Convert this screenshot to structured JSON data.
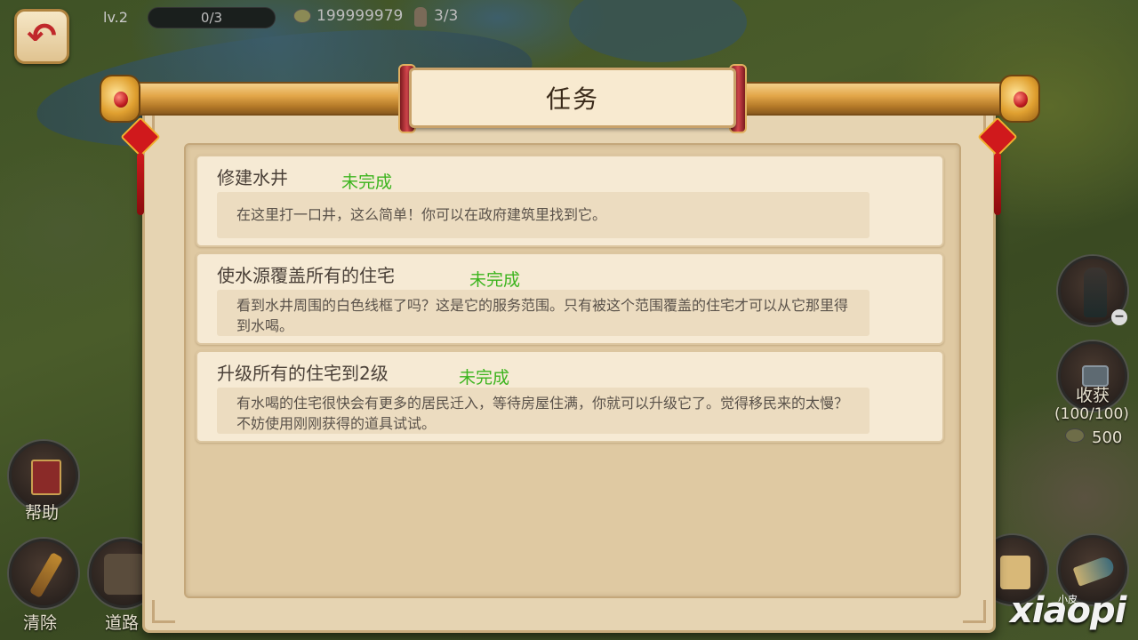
{
  "hud": {
    "level": "lv.2",
    "progress": "0/3",
    "gold": "199999979",
    "population": "3/3"
  },
  "dialog": {
    "title": "任务"
  },
  "tasks": [
    {
      "name": "修建水井",
      "status": "未完成",
      "description": "在这里打一口井，这么简单！你可以在政府建筑里找到它。"
    },
    {
      "name": "使水源覆盖所有的住宅",
      "status": "未完成",
      "description": "看到水井周围的白色线框了吗？这是它的服务范围。只有被这个范围覆盖的住宅才可以从它那里得到水喝。"
    },
    {
      "name": "升级所有的住宅到2级",
      "status": "未完成",
      "description": "有水喝的住宅很快会有更多的居民迁入，等待房屋住满，你就可以升级它了。觉得移民来的太慢？不妨使用刚刚获得的道具试试。"
    }
  ],
  "side": {
    "help_label": "帮助",
    "clear_label": "清除",
    "road_label": "道路",
    "harvest_label": "收获",
    "harvest_count": "(100/100)",
    "harvest_coins": "500"
  },
  "watermark": {
    "main": "xiaopi",
    "small": "小皮"
  },
  "colors": {
    "status_incomplete": "#3cb41e",
    "back_arrow": "#c0282a"
  }
}
